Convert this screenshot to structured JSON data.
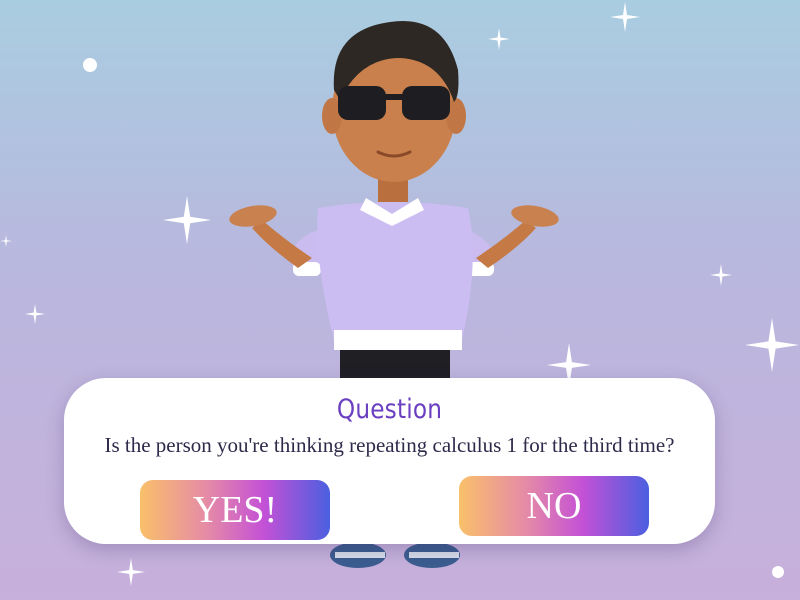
{
  "question_card": {
    "title": "Question",
    "text": "Is the person you're thinking repeating calculus 1 for the third time?"
  },
  "answers": {
    "yes_label": "YES!",
    "no_label": "NO"
  },
  "colors": {
    "background_top": "#a9cde0",
    "background_bottom": "#c7b0db",
    "title_color": "#6a3fc0",
    "text_color": "#2d2a4a",
    "button_gradient": [
      "#f9c06a",
      "#e58ba6",
      "#c451d6",
      "#4b5fe0"
    ]
  },
  "icons": {
    "sparkle": "sparkle-icon",
    "dot": "dot-icon"
  }
}
